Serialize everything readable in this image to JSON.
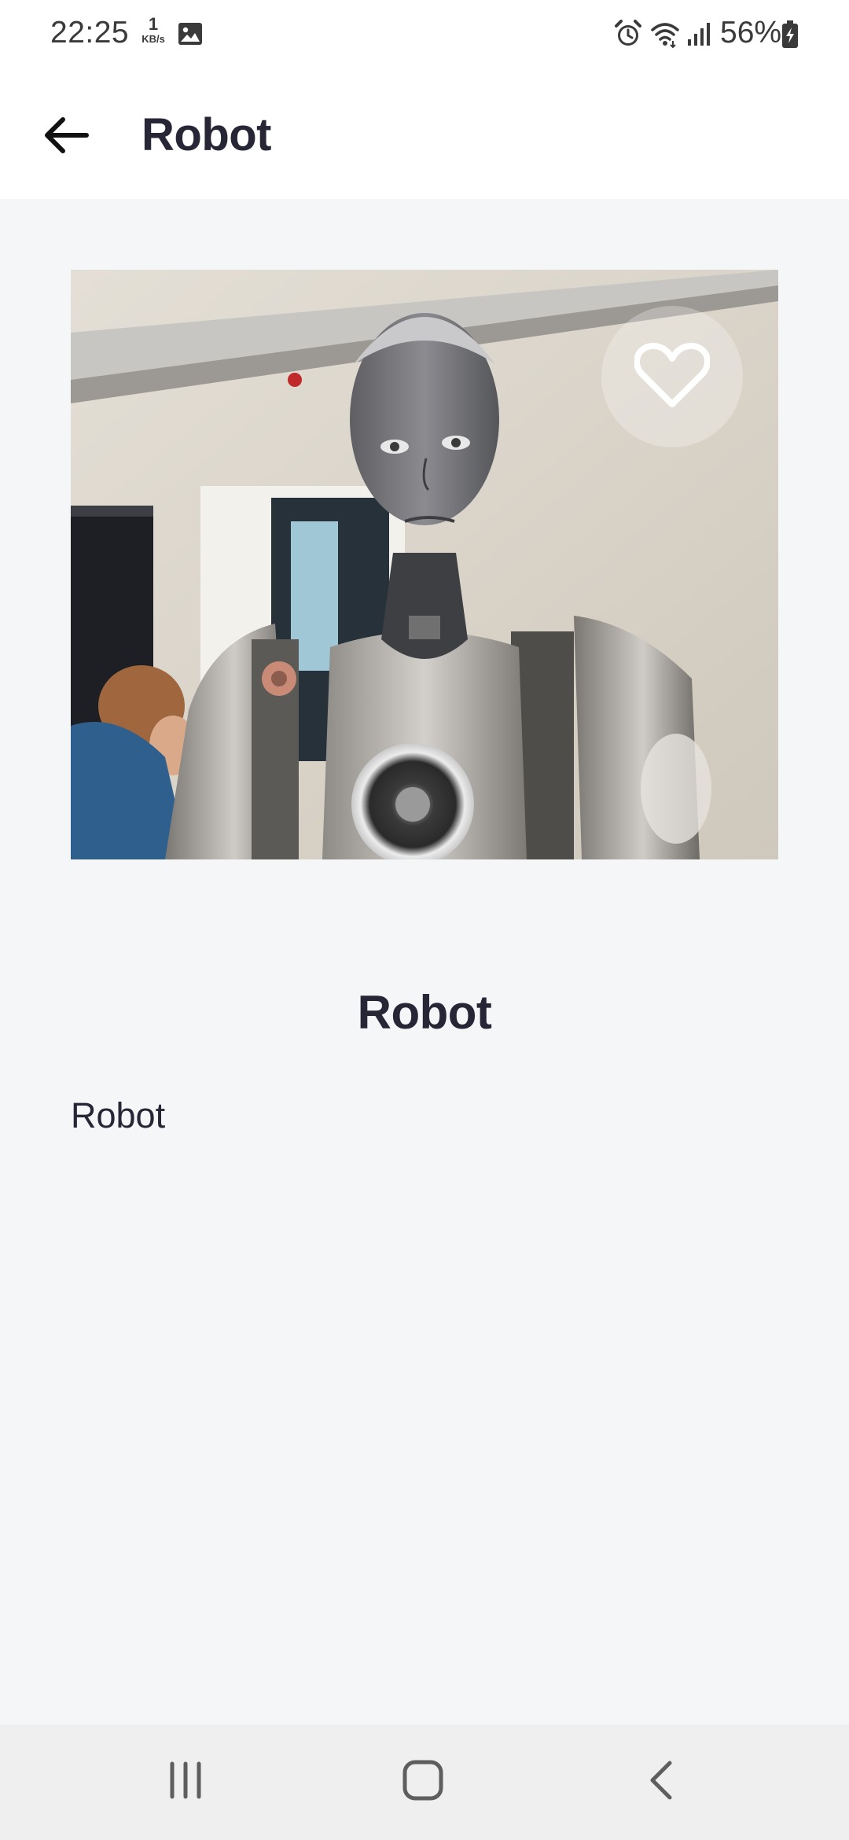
{
  "status_bar": {
    "time": "22:25",
    "net_speed_value": "1",
    "net_speed_unit": "KB/s",
    "battery_percent": "56%",
    "icons": [
      "gallery-icon",
      "alarm-icon",
      "wifi-icon",
      "signal-icon",
      "battery-charging-icon"
    ]
  },
  "app_bar": {
    "title": "Robot",
    "back_icon": "arrow-left-icon"
  },
  "detail": {
    "image_subject": "humanoid robot",
    "favorite_icon": "heart-outline-icon",
    "title": "Robot",
    "description": "Robot"
  },
  "nav_bar": {
    "icons": [
      "recents-icon",
      "home-icon",
      "back-icon"
    ]
  },
  "colors": {
    "title_text": "#262637",
    "content_background": "#f5f6f8",
    "app_bar_background": "#ffffff",
    "nav_bar_background": "#efefef"
  }
}
